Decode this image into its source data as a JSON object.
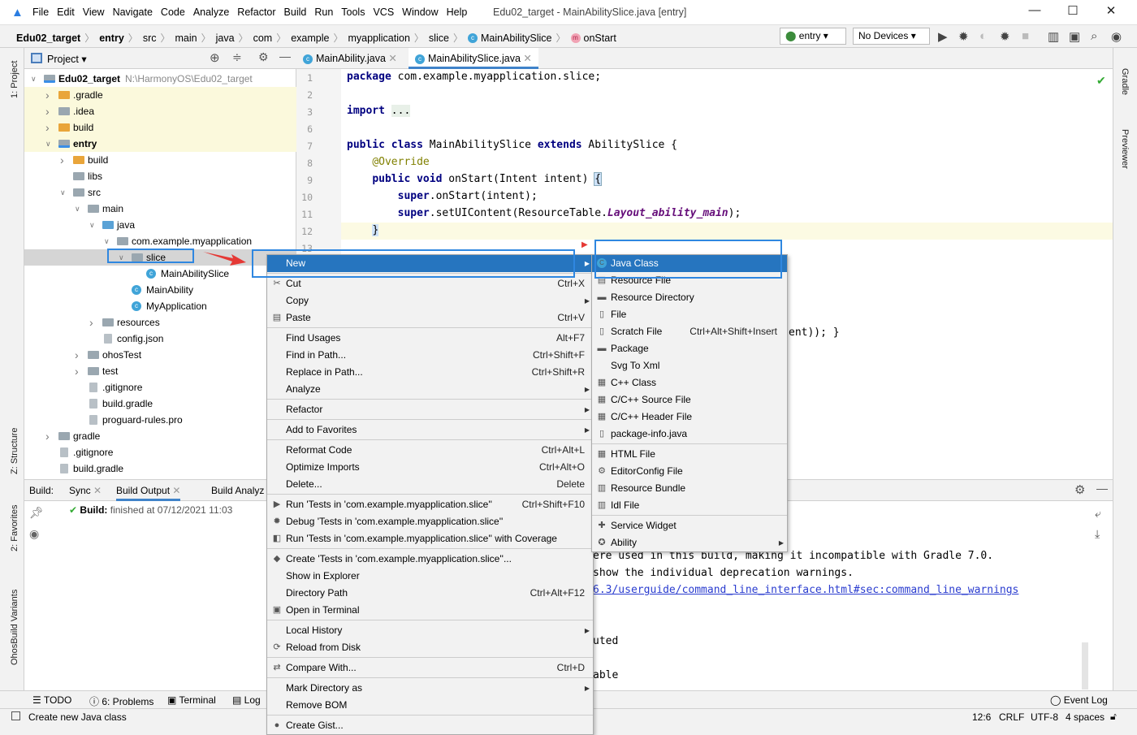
{
  "window": {
    "title": "Edu02_target - MainAbilitySlice.java [entry]",
    "menu": [
      "File",
      "Edit",
      "View",
      "Navigate",
      "Code",
      "Analyze",
      "Refactor",
      "Build",
      "Run",
      "Tools",
      "VCS",
      "Window",
      "Help"
    ]
  },
  "breadcrumb": [
    "Edu02_target",
    "entry",
    "src",
    "main",
    "java",
    "com",
    "example",
    "myapplication",
    "slice",
    "MainAbilitySlice",
    "onStart"
  ],
  "toolbar": {
    "config": "entry",
    "device": "No Devices"
  },
  "left_strip": [
    "1: Project",
    "Z: Structure",
    "2: Favorites",
    "OhosBuild Variants"
  ],
  "right_strip": [
    "Gradle",
    "Previewer"
  ],
  "project": {
    "title": "Project",
    "tree": [
      {
        "label": "Edu02_target",
        "path": "N:\\HarmonyOS\\Edu02_target",
        "level": 0,
        "state": "open",
        "bold": true,
        "icon": "module"
      },
      {
        "label": ".gradle",
        "level": 1,
        "state": "closed",
        "icon": "folder-orange",
        "yellow": true
      },
      {
        "label": ".idea",
        "level": 1,
        "state": "closed",
        "icon": "folder",
        "yellow": true
      },
      {
        "label": "build",
        "level": 1,
        "state": "closed",
        "icon": "folder-orange",
        "yellow": true
      },
      {
        "label": "entry",
        "level": 1,
        "state": "open",
        "bold": true,
        "icon": "module",
        "yellow": true
      },
      {
        "label": "build",
        "level": 2,
        "state": "closed",
        "icon": "folder-orange"
      },
      {
        "label": "libs",
        "level": 2,
        "state": "none",
        "icon": "folder"
      },
      {
        "label": "src",
        "level": 2,
        "state": "open",
        "icon": "folder"
      },
      {
        "label": "main",
        "level": 3,
        "state": "open",
        "icon": "folder"
      },
      {
        "label": "java",
        "level": 4,
        "state": "open",
        "icon": "folder-blue"
      },
      {
        "label": "com.example.myapplication",
        "level": 5,
        "state": "open",
        "icon": "package"
      },
      {
        "label": "slice",
        "level": 6,
        "state": "open",
        "icon": "package",
        "selected": true
      },
      {
        "label": "MainAbilitySlice",
        "level": 7,
        "state": "none",
        "icon": "class"
      },
      {
        "label": "MainAbility",
        "level": 6,
        "state": "none",
        "icon": "class"
      },
      {
        "label": "MyApplication",
        "level": 6,
        "state": "none",
        "icon": "class"
      },
      {
        "label": "resources",
        "level": 4,
        "state": "closed",
        "icon": "folder"
      },
      {
        "label": "config.json",
        "level": 4,
        "state": "none",
        "icon": "file"
      },
      {
        "label": "ohosTest",
        "level": 3,
        "state": "closed",
        "icon": "folder"
      },
      {
        "label": "test",
        "level": 3,
        "state": "closed",
        "icon": "folder"
      },
      {
        "label": ".gitignore",
        "level": 3,
        "state": "none",
        "icon": "file"
      },
      {
        "label": "build.gradle",
        "level": 3,
        "state": "none",
        "icon": "gradle"
      },
      {
        "label": "proguard-rules.pro",
        "level": 3,
        "state": "none",
        "icon": "file"
      },
      {
        "label": "gradle",
        "level": 1,
        "state": "closed",
        "icon": "folder"
      },
      {
        "label": ".gitignore",
        "level": 1,
        "state": "none",
        "icon": "file"
      },
      {
        "label": "build.gradle",
        "level": 1,
        "state": "none",
        "icon": "gradle"
      }
    ]
  },
  "editor": {
    "tabs": [
      "MainAbility.java",
      "MainAbilitySlice.java"
    ],
    "active_tab": 1,
    "lines": [
      {
        "n": "1",
        "html": "<span class='kw'>package</span> com.example.myapplication.slice;"
      },
      {
        "n": "2",
        "html": ""
      },
      {
        "n": "3",
        "html": "<span class='kw'>import</span> <span style='background:#e8f0e8'>...</span>"
      },
      {
        "n": "6",
        "html": ""
      },
      {
        "n": "7",
        "html": "<span class='kw'>public class</span> MainAbilitySlice <span class='kw'>extends</span> AbilitySlice {"
      },
      {
        "n": "8",
        "html": "    <span class='an'>@Override</span>"
      },
      {
        "n": "9",
        "html": "    <span class='kw'>public void</span> onStart(Intent intent) <span style='background:#cfe3f9;outline:1px solid #8ab'>{</span>"
      },
      {
        "n": "10",
        "html": "        <span class='kw'>super</span>.onStart(intent);"
      },
      {
        "n": "11",
        "html": "        <span class='kw'>super</span>.setUIContent(ResourceTable.<span class='it'>Layout_ability_main</span>);"
      },
      {
        "n": "12",
        "html": "    <span style='background:#cfe3f9'>}</span>"
      },
      {
        "n": "13",
        "html": ""
      }
    ],
    "fragment": "ent)); }"
  },
  "build": {
    "label": "Build:",
    "tabs": [
      "Sync",
      "Build Output",
      "Build Analyz"
    ],
    "status": "Build:",
    "status_rest": "finished at 07/12/2021 11:03",
    "output": [
      {
        "text": "ere used in this build, making it incompatible with Gradle 7.0."
      },
      {
        "text": "show the individual deprecation warnings."
      },
      {
        "text": "6.3/userguide/command_line_interface.html#sec:command_line_warnings",
        "link": true
      },
      {
        "text": "uted"
      },
      {
        "text": "able"
      }
    ]
  },
  "bottom_tabs": [
    "TODO",
    "6: Problems",
    "Terminal",
    "Log"
  ],
  "event_log": "Event Log",
  "status": {
    "message": "Create new Java class",
    "position": "12:6",
    "line_sep": "CRLF",
    "encoding": "UTF-8",
    "indent": "4 spaces"
  },
  "context_menu": [
    {
      "label": "New",
      "submenu": true,
      "highlight": true,
      "icon": ""
    },
    {
      "sep": true
    },
    {
      "label": "Cut",
      "shortcut": "Ctrl+X",
      "icon": "✂"
    },
    {
      "label": "Copy",
      "submenu": true
    },
    {
      "label": "Paste",
      "shortcut": "Ctrl+V",
      "icon": "▤"
    },
    {
      "sep": true
    },
    {
      "label": "Find Usages",
      "shortcut": "Alt+F7"
    },
    {
      "label": "Find in Path...",
      "shortcut": "Ctrl+Shift+F"
    },
    {
      "label": "Replace in Path...",
      "shortcut": "Ctrl+Shift+R"
    },
    {
      "label": "Analyze",
      "submenu": true
    },
    {
      "sep": true
    },
    {
      "label": "Refactor",
      "submenu": true
    },
    {
      "sep": true
    },
    {
      "label": "Add to Favorites",
      "submenu": true
    },
    {
      "sep": true
    },
    {
      "label": "Reformat Code",
      "shortcut": "Ctrl+Alt+L"
    },
    {
      "label": "Optimize Imports",
      "shortcut": "Ctrl+Alt+O"
    },
    {
      "label": "Delete...",
      "shortcut": "Delete"
    },
    {
      "sep": true
    },
    {
      "label": "Run 'Tests in 'com.example.myapplication.slice''",
      "shortcut": "Ctrl+Shift+F10",
      "icon": "▶"
    },
    {
      "label": "Debug 'Tests in 'com.example.myapplication.slice''",
      "icon": "✹"
    },
    {
      "label": "Run 'Tests in 'com.example.myapplication.slice'' with Coverage",
      "icon": "◧"
    },
    {
      "sep": true
    },
    {
      "label": "Create 'Tests in 'com.example.myapplication.slice''...",
      "icon": "◆"
    },
    {
      "label": "Show in Explorer"
    },
    {
      "label": "Directory Path",
      "shortcut": "Ctrl+Alt+F12"
    },
    {
      "label": "Open in Terminal",
      "icon": "▣"
    },
    {
      "sep": true
    },
    {
      "label": "Local History",
      "submenu": true
    },
    {
      "label": "Reload from Disk",
      "icon": "⟳"
    },
    {
      "sep": true
    },
    {
      "label": "Compare With...",
      "shortcut": "Ctrl+D",
      "icon": "⇄"
    },
    {
      "sep": true
    },
    {
      "label": "Mark Directory as",
      "submenu": true
    },
    {
      "label": "Remove BOM"
    },
    {
      "sep": true
    },
    {
      "label": "Create Gist...",
      "icon": "●"
    }
  ],
  "new_submenu": [
    {
      "label": "Java Class",
      "highlight": true,
      "icon": "C"
    },
    {
      "label": "Resource File",
      "icon": "▤"
    },
    {
      "label": "Resource Directory",
      "icon": "▬"
    },
    {
      "label": "File",
      "icon": "▯"
    },
    {
      "label": "Scratch File",
      "shortcut": "Ctrl+Alt+Shift+Insert",
      "icon": "▯"
    },
    {
      "label": "Package",
      "icon": "▬"
    },
    {
      "label": "Svg To Xml",
      "icon": ""
    },
    {
      "label": "C++ Class",
      "icon": "▦"
    },
    {
      "label": "C/C++ Source File",
      "icon": "▦"
    },
    {
      "label": "C/C++ Header File",
      "icon": "▦"
    },
    {
      "label": "package-info.java",
      "icon": "▯"
    },
    {
      "sep": true
    },
    {
      "label": "HTML File",
      "icon": "▦"
    },
    {
      "label": "EditorConfig File",
      "icon": "⚙"
    },
    {
      "label": "Resource Bundle",
      "icon": "▥"
    },
    {
      "label": "Idl File",
      "icon": "▥"
    },
    {
      "sep": true
    },
    {
      "label": "Service Widget",
      "icon": "✚"
    },
    {
      "label": "Ability",
      "submenu": true,
      "icon": "✪"
    }
  ],
  "colors": {
    "accent": "#2675bf",
    "highlight_box": "#2f87e0",
    "arrow": "#e53935"
  }
}
